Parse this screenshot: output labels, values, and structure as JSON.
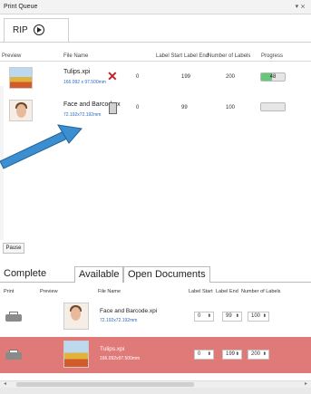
{
  "panel": {
    "title": "Print Queue",
    "pin_icon": "pin-icon"
  },
  "rip": {
    "label": "RIP"
  },
  "queue": {
    "columns": [
      "Preview",
      "File Name",
      "Label Start",
      "Label End",
      "Number of Labels",
      "Progress"
    ],
    "rows": [
      {
        "file": "Tulips.xpi",
        "size": "166.092 x 97.500mm",
        "label_start": "0",
        "label_end": "199",
        "count": "200",
        "progress": "48",
        "progress_fraction": 0.48,
        "action_icon": "cancel-x-icon"
      },
      {
        "file": "Face and Barcode.x",
        "size": "72.192x72.192mm",
        "label_start": "0",
        "label_end": "99",
        "count": "100",
        "progress": "",
        "progress_fraction": 0.0,
        "action_icon": "trash-icon"
      }
    ]
  },
  "pause_label": "Pause",
  "tabs": [
    "Complete",
    "Available",
    "Open Documents"
  ],
  "docs": {
    "columns": [
      "Print",
      "Preview",
      "File Name",
      "Label Start",
      "Label End",
      "Number of Labels"
    ],
    "rows": [
      {
        "file": "Face and Barcode.xpi",
        "size": "72.192x72.192mm",
        "label_start": "0",
        "label_end": "99",
        "count": "100",
        "highlighted": false
      },
      {
        "file": "Tulips.xpi",
        "size": "166.092x97.500mm",
        "label_start": "0",
        "label_end": "199",
        "count": "200",
        "highlighted": true
      }
    ]
  },
  "colors": {
    "highlight_row": "#e07a79",
    "progress_fill": "#69c77a",
    "arrow": "#3b8fd0"
  }
}
